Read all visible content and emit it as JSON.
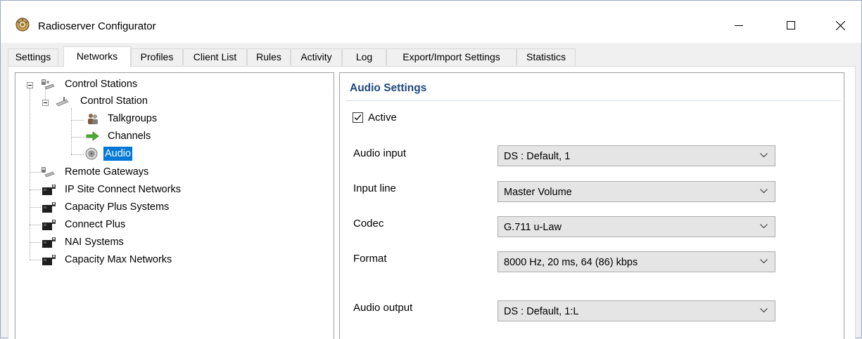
{
  "window": {
    "title": "Radioserver Configurator",
    "app_icon": "radioserver-app-icon",
    "controls": [
      "minimize-icon",
      "maximize-icon",
      "close-icon"
    ]
  },
  "tabs": [
    {
      "label": "Settings",
      "active": false
    },
    {
      "label": "Networks",
      "active": true
    },
    {
      "label": "Profiles",
      "active": false
    },
    {
      "label": "Client List",
      "active": false
    },
    {
      "label": "Rules",
      "active": false
    },
    {
      "label": "Activity",
      "active": false
    },
    {
      "label": "Log",
      "active": false
    },
    {
      "label": "Export/Import Settings",
      "active": false
    },
    {
      "label": "Statistics",
      "active": false
    }
  ],
  "tree": {
    "nodes": [
      {
        "label": "Control Stations",
        "icon": "control-stations-icon",
        "expanded": true
      },
      {
        "label": "Control Station",
        "icon": "control-station-icon",
        "expanded": true
      },
      {
        "label": "Talkgroups",
        "icon": "talkgroups-icon"
      },
      {
        "label": "Channels",
        "icon": "channels-arrow-icon"
      },
      {
        "label": "Audio",
        "icon": "audio-speaker-icon",
        "selected": true
      },
      {
        "label": "Remote Gateways",
        "icon": "remote-gateways-icon"
      },
      {
        "label": "IP Site Connect Networks",
        "icon": "network-icon"
      },
      {
        "label": "Capacity Plus Systems",
        "icon": "network-icon"
      },
      {
        "label": "Connect Plus",
        "icon": "network-icon"
      },
      {
        "label": "NAI Systems",
        "icon": "network-icon"
      },
      {
        "label": "Capacity Max Networks",
        "icon": "network-icon"
      }
    ]
  },
  "audio_settings": {
    "title": "Audio Settings",
    "active_label": "Active",
    "active_checked": true,
    "fields": [
      {
        "label": "Audio input",
        "value": "DS : Default, 1"
      },
      {
        "label": "Input line",
        "value": "Master Volume"
      },
      {
        "label": "Codec",
        "value": "G.711 u-Law"
      },
      {
        "label": "Format",
        "value": "8000 Hz, 20 ms, 64 (86) kbps"
      },
      {
        "label": "Audio output",
        "value": "DS : Default, 1:L"
      }
    ]
  },
  "colors": {
    "section_title": "#1f497d",
    "selection": "#0078d7",
    "combo_bg": "#e5e5e5"
  }
}
